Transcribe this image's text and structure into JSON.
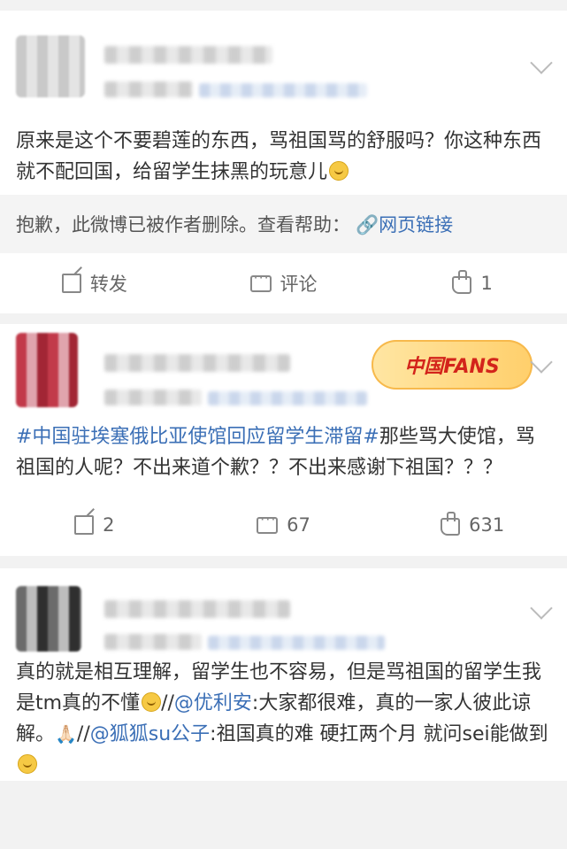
{
  "posts": [
    {
      "text_segments": [
        {
          "type": "text",
          "value": "原来是这个不要碧莲的东西，骂祖国骂的舒服吗？你这种东西就不配回国，给留学生抹黑的玩意儿"
        },
        {
          "type": "emoji",
          "value": "smile-emoji"
        }
      ],
      "deleted_notice": {
        "text": "抱歉，此微博已被作者删除。查看帮助：",
        "link": "网页链接"
      },
      "actions": {
        "repost": "转发",
        "comment": "评论",
        "like": "1"
      }
    },
    {
      "badge": "中国FANS",
      "topic": "#中国驻埃塞俄比亚使馆回应留学生滞留#",
      "text": "那些骂大使馆，骂祖国的人呢？不出来道个歉？？不出来感谢下祖国？？？",
      "actions": {
        "repost": "2",
        "comment": "67",
        "like": "631"
      }
    },
    {
      "text_parts": {
        "p1": "真的就是相互理解，留学生也不容易，但是骂祖国的留学生我是tm真的不懂",
        "p2": "//",
        "mention1": "@优利安",
        "p3": ":大家都很难，真的一家人彼此谅解。",
        "hands": "🙏🏻",
        "p4": "//",
        "mention2": "@狐狐su公子",
        "p5": ":祖国真的难 硬扛两个月 就问sei能做到"
      }
    }
  ]
}
